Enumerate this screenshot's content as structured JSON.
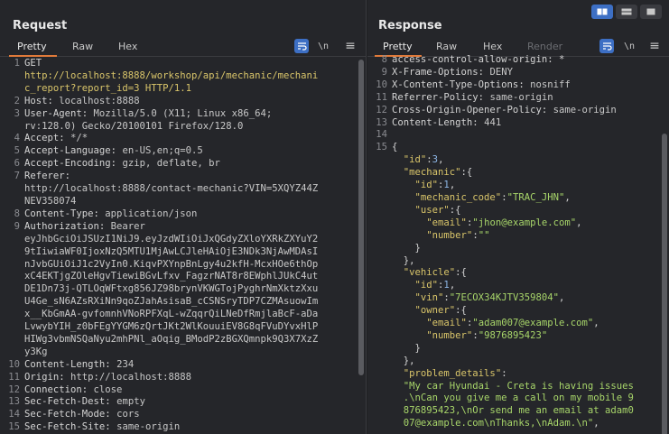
{
  "request": {
    "title": "Request",
    "tabs": [
      "Pretty",
      "Raw",
      "Hex"
    ],
    "tool_newline": "\\n",
    "tool_menu": "≡",
    "lines": [
      {
        "n": "1",
        "segs": [
          {
            "t": "GET",
            "c": "hname"
          }
        ]
      },
      {
        "n": "",
        "segs": [
          {
            "t": "http://localhost:8888/workshop/api/mechanic/mechani",
            "c": "url"
          }
        ]
      },
      {
        "n": "",
        "segs": [
          {
            "t": "c_report?report_id=3 HTTP/1.1",
            "c": "url"
          }
        ]
      },
      {
        "n": "2",
        "segs": [
          {
            "t": "Host: ",
            "c": "hname"
          },
          {
            "t": "localhost:8888",
            "c": "hval"
          }
        ]
      },
      {
        "n": "3",
        "segs": [
          {
            "t": "User-Agent: ",
            "c": "hname"
          },
          {
            "t": "Mozilla/5.0 (X11; Linux x86_64;",
            "c": "hval"
          }
        ]
      },
      {
        "n": "",
        "segs": [
          {
            "t": "rv:128.0) Gecko/20100101 Firefox/128.0",
            "c": "hval"
          }
        ]
      },
      {
        "n": "4",
        "segs": [
          {
            "t": "Accept: ",
            "c": "hname"
          },
          {
            "t": "*/*",
            "c": "hval"
          }
        ]
      },
      {
        "n": "5",
        "segs": [
          {
            "t": "Accept-Language: ",
            "c": "hname"
          },
          {
            "t": "en-US,en;q=0.5",
            "c": "hval"
          }
        ]
      },
      {
        "n": "6",
        "segs": [
          {
            "t": "Accept-Encoding: ",
            "c": "hname"
          },
          {
            "t": "gzip, deflate, br",
            "c": "hval"
          }
        ]
      },
      {
        "n": "7",
        "segs": [
          {
            "t": "Referer:",
            "c": "hname"
          }
        ]
      },
      {
        "n": "",
        "segs": [
          {
            "t": "http://localhost:8888/contact-mechanic?VIN=5XQYZ44Z",
            "c": "hval"
          }
        ]
      },
      {
        "n": "",
        "segs": [
          {
            "t": "NEV358074",
            "c": "hval"
          }
        ]
      },
      {
        "n": "8",
        "segs": [
          {
            "t": "Content-Type: ",
            "c": "hname"
          },
          {
            "t": "application/json",
            "c": "hval"
          }
        ]
      },
      {
        "n": "9",
        "segs": [
          {
            "t": "Authorization: ",
            "c": "hname"
          },
          {
            "t": "Bearer",
            "c": "hval"
          }
        ]
      },
      {
        "n": "",
        "segs": [
          {
            "t": "eyJhbGciOiJSUzI1NiJ9.eyJzdWIiOiJxQGdyZXloYXRkZXYuY2",
            "c": "hval"
          }
        ]
      },
      {
        "n": "",
        "segs": [
          {
            "t": "9tIiwiaWF0IjoxNzQ5MTU1MjAwLCJleHAiOjE3NDk3NjAwMDAsI",
            "c": "hval"
          }
        ]
      },
      {
        "n": "",
        "segs": [
          {
            "t": "nJvbGUiOiJ1c2VyIn0.KiqvPXYnpBnLgy4u2kfH-McxHOe6thOp",
            "c": "hval"
          }
        ]
      },
      {
        "n": "",
        "segs": [
          {
            "t": "xC4EKTjgZOleHgvTiewiBGvLfxv_FagzrNAT8r8EWphlJUkC4ut",
            "c": "hval"
          }
        ]
      },
      {
        "n": "",
        "segs": [
          {
            "t": "DE1Dn73j-QTLOqWFtxg856JZ98brynVKWGTojPyghrNmXktzXxu",
            "c": "hval"
          }
        ]
      },
      {
        "n": "",
        "segs": [
          {
            "t": "U4Ge_sN6AZsRXiNn9qoZJahAsisaB_cCSNSryTDP7CZMAsuowIm",
            "c": "hval"
          }
        ]
      },
      {
        "n": "",
        "segs": [
          {
            "t": "x__KbGmAA-gvfomnhVNoRPFXqL-wZqqrQiLNeDfRmjlaBcF-aDa",
            "c": "hval"
          }
        ]
      },
      {
        "n": "",
        "segs": [
          {
            "t": "LvwybYIH_z0bFEgYYGM6zQrtJKt2WlKouuiEV8G8qFVuDYvxHlP",
            "c": "hval"
          }
        ]
      },
      {
        "n": "",
        "segs": [
          {
            "t": "HIWg3vbmNSQaNyu2mhPNl_aOqig_BModP2zBGXQmnpk9Q3X7XzZ",
            "c": "hval"
          }
        ]
      },
      {
        "n": "",
        "segs": [
          {
            "t": "y3Kg",
            "c": "hval"
          }
        ]
      },
      {
        "n": "10",
        "segs": [
          {
            "t": "Content-Length: ",
            "c": "hname"
          },
          {
            "t": "234",
            "c": "hval"
          }
        ]
      },
      {
        "n": "11",
        "segs": [
          {
            "t": "Origin: ",
            "c": "hname"
          },
          {
            "t": "http://localhost:8888",
            "c": "hval"
          }
        ]
      },
      {
        "n": "12",
        "segs": [
          {
            "t": "Connection: ",
            "c": "hname"
          },
          {
            "t": "close",
            "c": "hval"
          }
        ]
      },
      {
        "n": "13",
        "segs": [
          {
            "t": "Sec-Fetch-Dest: ",
            "c": "hname"
          },
          {
            "t": "empty",
            "c": "hval"
          }
        ]
      },
      {
        "n": "14",
        "segs": [
          {
            "t": "Sec-Fetch-Mode: ",
            "c": "hname"
          },
          {
            "t": "cors",
            "c": "hval"
          }
        ]
      },
      {
        "n": "15",
        "segs": [
          {
            "t": "Sec-Fetch-Site: ",
            "c": "hname"
          },
          {
            "t": "same-origin",
            "c": "hval"
          }
        ]
      }
    ]
  },
  "response": {
    "title": "Response",
    "tabs": [
      "Pretty",
      "Raw",
      "Hex",
      "Render"
    ],
    "tool_newline": "\\n",
    "tool_menu": "≡",
    "lines": [
      {
        "n": "8",
        "segs": [
          {
            "t": "access-control-allow-origin: *",
            "c": "hname"
          }
        ]
      },
      {
        "n": "9",
        "segs": [
          {
            "t": "X-Frame-Options: ",
            "c": "hname"
          },
          {
            "t": "DENY",
            "c": "hval"
          }
        ]
      },
      {
        "n": "10",
        "segs": [
          {
            "t": "X-Content-Type-Options: ",
            "c": "hname"
          },
          {
            "t": "nosniff",
            "c": "hval"
          }
        ]
      },
      {
        "n": "11",
        "segs": [
          {
            "t": "Referrer-Policy: ",
            "c": "hname"
          },
          {
            "t": "same-origin",
            "c": "hval"
          }
        ]
      },
      {
        "n": "12",
        "segs": [
          {
            "t": "Cross-Origin-Opener-Policy: ",
            "c": "hname"
          },
          {
            "t": "same-origin",
            "c": "hval"
          }
        ]
      },
      {
        "n": "13",
        "segs": [
          {
            "t": "Content-Length: ",
            "c": "hname"
          },
          {
            "t": "441",
            "c": "hval"
          }
        ]
      },
      {
        "n": "14",
        "segs": [
          {
            "t": "",
            "c": "hval"
          }
        ]
      },
      {
        "n": "15",
        "segs": [
          {
            "t": "{",
            "c": "jpunc"
          }
        ]
      },
      {
        "n": "",
        "segs": [
          {
            "t": "  ",
            "c": "jpunc"
          },
          {
            "t": "\"id\"",
            "c": "jkey"
          },
          {
            "t": ":",
            "c": "jpunc"
          },
          {
            "t": "3",
            "c": "jnum"
          },
          {
            "t": ",",
            "c": "jpunc"
          }
        ]
      },
      {
        "n": "",
        "segs": [
          {
            "t": "  ",
            "c": "jpunc"
          },
          {
            "t": "\"mechanic\"",
            "c": "jkey"
          },
          {
            "t": ":{",
            "c": "jpunc"
          }
        ]
      },
      {
        "n": "",
        "segs": [
          {
            "t": "    ",
            "c": "jpunc"
          },
          {
            "t": "\"id\"",
            "c": "jkey"
          },
          {
            "t": ":",
            "c": "jpunc"
          },
          {
            "t": "1",
            "c": "jnum"
          },
          {
            "t": ",",
            "c": "jpunc"
          }
        ]
      },
      {
        "n": "",
        "segs": [
          {
            "t": "    ",
            "c": "jpunc"
          },
          {
            "t": "\"mechanic_code\"",
            "c": "jkey"
          },
          {
            "t": ":",
            "c": "jpunc"
          },
          {
            "t": "\"TRAC_JHN\"",
            "c": "jstr"
          },
          {
            "t": ",",
            "c": "jpunc"
          }
        ]
      },
      {
        "n": "",
        "segs": [
          {
            "t": "    ",
            "c": "jpunc"
          },
          {
            "t": "\"user\"",
            "c": "jkey"
          },
          {
            "t": ":{",
            "c": "jpunc"
          }
        ]
      },
      {
        "n": "",
        "segs": [
          {
            "t": "      ",
            "c": "jpunc"
          },
          {
            "t": "\"email\"",
            "c": "jkey"
          },
          {
            "t": ":",
            "c": "jpunc"
          },
          {
            "t": "\"jhon@example.com\"",
            "c": "jstr"
          },
          {
            "t": ",",
            "c": "jpunc"
          }
        ]
      },
      {
        "n": "",
        "segs": [
          {
            "t": "      ",
            "c": "jpunc"
          },
          {
            "t": "\"number\"",
            "c": "jkey"
          },
          {
            "t": ":",
            "c": "jpunc"
          },
          {
            "t": "\"\"",
            "c": "jstr"
          }
        ]
      },
      {
        "n": "",
        "segs": [
          {
            "t": "    }",
            "c": "jpunc"
          }
        ]
      },
      {
        "n": "",
        "segs": [
          {
            "t": "  },",
            "c": "jpunc"
          }
        ]
      },
      {
        "n": "",
        "segs": [
          {
            "t": "  ",
            "c": "jpunc"
          },
          {
            "t": "\"vehicle\"",
            "c": "jkey"
          },
          {
            "t": ":{",
            "c": "jpunc"
          }
        ]
      },
      {
        "n": "",
        "segs": [
          {
            "t": "    ",
            "c": "jpunc"
          },
          {
            "t": "\"id\"",
            "c": "jkey"
          },
          {
            "t": ":",
            "c": "jpunc"
          },
          {
            "t": "1",
            "c": "jnum"
          },
          {
            "t": ",",
            "c": "jpunc"
          }
        ]
      },
      {
        "n": "",
        "segs": [
          {
            "t": "    ",
            "c": "jpunc"
          },
          {
            "t": "\"vin\"",
            "c": "jkey"
          },
          {
            "t": ":",
            "c": "jpunc"
          },
          {
            "t": "\"7ECOX34KJTV359804\"",
            "c": "jstr"
          },
          {
            "t": ",",
            "c": "jpunc"
          }
        ]
      },
      {
        "n": "",
        "segs": [
          {
            "t": "    ",
            "c": "jpunc"
          },
          {
            "t": "\"owner\"",
            "c": "jkey"
          },
          {
            "t": ":{",
            "c": "jpunc"
          }
        ]
      },
      {
        "n": "",
        "segs": [
          {
            "t": "      ",
            "c": "jpunc"
          },
          {
            "t": "\"email\"",
            "c": "jkey"
          },
          {
            "t": ":",
            "c": "jpunc"
          },
          {
            "t": "\"adam007@example.com\"",
            "c": "jstr"
          },
          {
            "t": ",",
            "c": "jpunc"
          }
        ]
      },
      {
        "n": "",
        "segs": [
          {
            "t": "      ",
            "c": "jpunc"
          },
          {
            "t": "\"number\"",
            "c": "jkey"
          },
          {
            "t": ":",
            "c": "jpunc"
          },
          {
            "t": "\"9876895423\"",
            "c": "jstr"
          }
        ]
      },
      {
        "n": "",
        "segs": [
          {
            "t": "    }",
            "c": "jpunc"
          }
        ]
      },
      {
        "n": "",
        "segs": [
          {
            "t": "  },",
            "c": "jpunc"
          }
        ]
      },
      {
        "n": "",
        "segs": [
          {
            "t": "  ",
            "c": "jpunc"
          },
          {
            "t": "\"problem_details\"",
            "c": "jkey"
          },
          {
            "t": ":",
            "c": "jpunc"
          }
        ]
      },
      {
        "n": "",
        "segs": [
          {
            "t": "  \"My car Hyundai - Creta is having issues",
            "c": "jstr"
          }
        ]
      },
      {
        "n": "",
        "segs": [
          {
            "t": "  .\\nCan you give me a call on my mobile 9",
            "c": "jstr"
          }
        ]
      },
      {
        "n": "",
        "segs": [
          {
            "t": "  876895423,\\nOr send me an email at adam0",
            "c": "jstr"
          }
        ]
      },
      {
        "n": "",
        "segs": [
          {
            "t": "  07@example.com\\nThanks,\\nAdam.\\n\"",
            "c": "jstr"
          },
          {
            "t": ",",
            "c": "jpunc"
          }
        ]
      }
    ]
  },
  "colors": {
    "accent": "#3d6fc4",
    "tab_underline": "#e07a3a",
    "url": "#d9c56a",
    "json_key": "#d9c56a",
    "json_string": "#a8d66a",
    "json_number": "#8fb8e8"
  }
}
